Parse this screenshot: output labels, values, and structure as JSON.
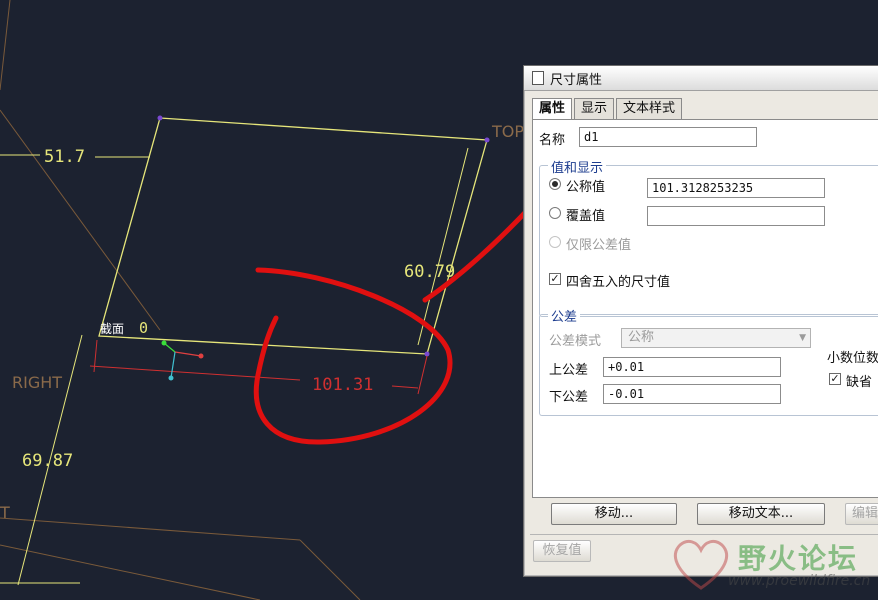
{
  "cad": {
    "dim_top": "51.7",
    "dim_right": "60.79",
    "dim_bottom": "101.31",
    "dim_left": "69.87",
    "section_label": "截面",
    "section_number": "0",
    "plane_top": "TOP",
    "plane_right": "RIGHT",
    "plane_front_partial": "T"
  },
  "dialog": {
    "title": "尺寸属性",
    "tabs": [
      {
        "label": "属性",
        "active": true
      },
      {
        "label": "显示",
        "active": false
      },
      {
        "label": "文本样式",
        "active": false
      }
    ],
    "name_label": "名称",
    "name_value": "d1",
    "value_group_title": "值和显示",
    "nominal_label": "公称值",
    "nominal_value": "101.3128253235",
    "override_label": "覆盖值",
    "override_value": "",
    "tolerance_only_label": "仅限公差值",
    "round_label": "四舍五入的尺寸值",
    "tolerance_group_title": "公差",
    "tol_mode_label": "公差模式",
    "tol_mode_value": "公称",
    "upper_label": "上公差",
    "upper_value": "+0.01",
    "lower_label": "下公差",
    "lower_value": "-0.01",
    "decimals_label": "小数位数",
    "default_label": "缺省",
    "move_button": "移动...",
    "move_text_button": "移动文本...",
    "edit_button": "编辑",
    "restore_button": "恢复值"
  },
  "watermark": {
    "main": "野火论坛",
    "sub": "www.proewildfire.cn"
  },
  "colors": {
    "background": "#1c2230",
    "sketch": "#e6e67a",
    "dimension_red": "#d03030",
    "annotation_red": "#e01010",
    "dialog_bg": "#ece9e2"
  }
}
